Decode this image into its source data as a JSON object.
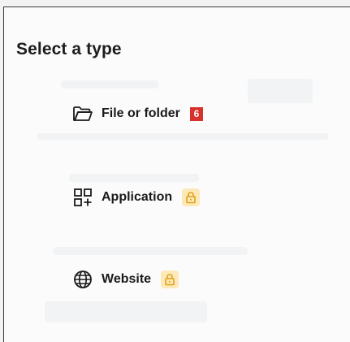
{
  "dialog": {
    "title": "Select a type"
  },
  "options": [
    {
      "label": "File or folder",
      "icon": "folder-icon",
      "badge": "6"
    },
    {
      "label": "Application",
      "icon": "apps-add-icon",
      "status_icon": "lock-icon"
    },
    {
      "label": "Website",
      "icon": "globe-icon",
      "status_icon": "lock-icon"
    }
  ],
  "colors": {
    "text": "#1a1a1a",
    "badge_red": "#d8302a",
    "lock_bg": "#fde9b8",
    "lock_fg": "#e0a21a",
    "panel_bg": "#fbfbfb"
  }
}
